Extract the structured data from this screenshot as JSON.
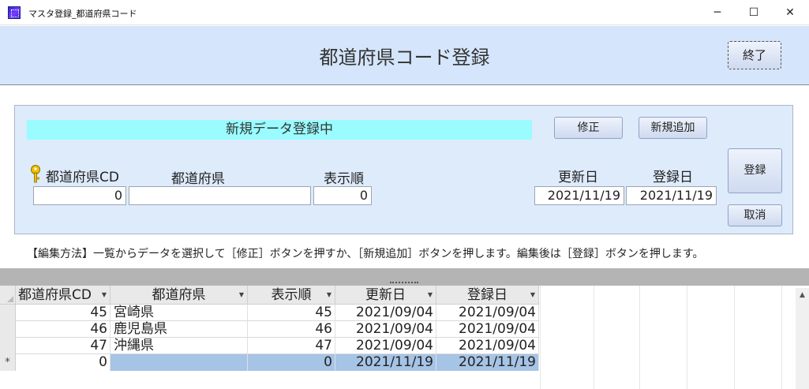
{
  "window": {
    "title": "マスタ登録_都道府県コード",
    "minimize": "─",
    "maximize": "☐",
    "close": "✕"
  },
  "header": {
    "title": "都道府県コード登録",
    "exit_label": "終了"
  },
  "form": {
    "status": "新規データ登録中",
    "edit_label": "修正",
    "new_label": "新規追加",
    "register_label": "登録",
    "cancel_label": "取消",
    "labels": {
      "code": "都道府県CD",
      "prefecture": "都道府県",
      "order": "表示順",
      "updated": "更新日",
      "registered": "登録日"
    },
    "values": {
      "code": "0",
      "prefecture": "",
      "order": "0",
      "updated": "2021/11/19",
      "registered": "2021/11/19"
    },
    "help_text": "【編集方法】一覧からデータを選択して［修正］ボタンを押すか、［新規追加］ボタンを押します。編集後は［登録］ボタンを押します。"
  },
  "table": {
    "columns": [
      "都道府県CD",
      "都道府県",
      "表示順",
      "更新日",
      "登録日"
    ],
    "rows": [
      {
        "code": "45",
        "prefecture": "宮崎県",
        "order": "45",
        "updated": "2021/09/04",
        "registered": "2021/09/04"
      },
      {
        "code": "46",
        "prefecture": "鹿児島県",
        "order": "46",
        "updated": "2021/09/04",
        "registered": "2021/09/04"
      },
      {
        "code": "47",
        "prefecture": "沖縄県",
        "order": "47",
        "updated": "2021/09/04",
        "registered": "2021/09/04"
      }
    ],
    "new_row": {
      "marker": "*",
      "code": "0",
      "prefecture": "",
      "order": "0",
      "updated": "2021/11/19",
      "registered": "2021/11/19"
    }
  },
  "colors": {
    "header_bg": "#d5e5fb",
    "panel_bg": "#deebfb",
    "status_bg": "#9afcff",
    "selection": "#a6c4e6"
  }
}
